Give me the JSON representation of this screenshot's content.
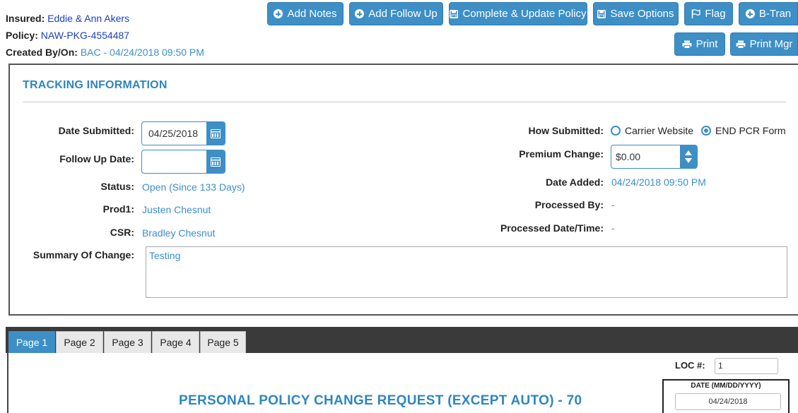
{
  "header": {
    "insured_label": "Insured:",
    "insured_value": "Eddie & Ann Akers",
    "policy_label": "Policy:",
    "policy_value": "NAW-PKG-4554487",
    "created_label": "Created By/On:",
    "created_value": "BAC - 04/24/2018 09:50 PM"
  },
  "toolbar": {
    "add_notes": "Add Notes",
    "add_follow_up": "Add Follow Up",
    "complete_update": "Complete & Update Policy",
    "save_options": "Save Options",
    "flag": "Flag",
    "b_tran": "B-Tran",
    "print": "Print",
    "print_mgr": "Print Mgr"
  },
  "tracking": {
    "title": "TRACKING INFORMATION",
    "date_submitted_label": "Date Submitted:",
    "date_submitted_value": "04/25/2018",
    "follow_up_label": "Follow Up Date:",
    "follow_up_value": "",
    "status_label": "Status:",
    "status_value": "Open (Since 133 Days)",
    "prod1_label": "Prod1:",
    "prod1_value": "Justen Chesnut",
    "csr_label": "CSR:",
    "csr_value": "Bradley Chesnut",
    "summary_label": "Summary Of Change:",
    "summary_value": "Testing",
    "how_submitted_label": "How Submitted:",
    "how_submitted_options": [
      "Carrier Website",
      "END PCR Form"
    ],
    "how_submitted_selected": "END PCR Form",
    "premium_change_label": "Premium Change:",
    "premium_change_value": "$0.00",
    "date_added_label": "Date Added:",
    "date_added_value": "04/24/2018 09:50 PM",
    "processed_by_label": "Processed By:",
    "processed_by_value": "-",
    "processed_dt_label": "Processed Date/Time:",
    "processed_dt_value": "-"
  },
  "pages": {
    "tabs": [
      "Page 1",
      "Page 2",
      "Page 3",
      "Page 4",
      "Page 5"
    ],
    "active": "Page 1"
  },
  "form": {
    "loc_label": "LOC #:",
    "loc_value": "1",
    "date_label": "DATE (MM/DD/YYYY)",
    "date_value": "04/24/2018",
    "title": "PERSONAL POLICY CHANGE REQUEST (EXCEPT AUTO) - 70"
  },
  "colors": {
    "accent": "#3d8fc6",
    "link_blue": "#1a3fc2",
    "value_blue": "#3a8fcf",
    "title_blue": "#2e86c1",
    "tabbar": "#3a3a3a"
  }
}
